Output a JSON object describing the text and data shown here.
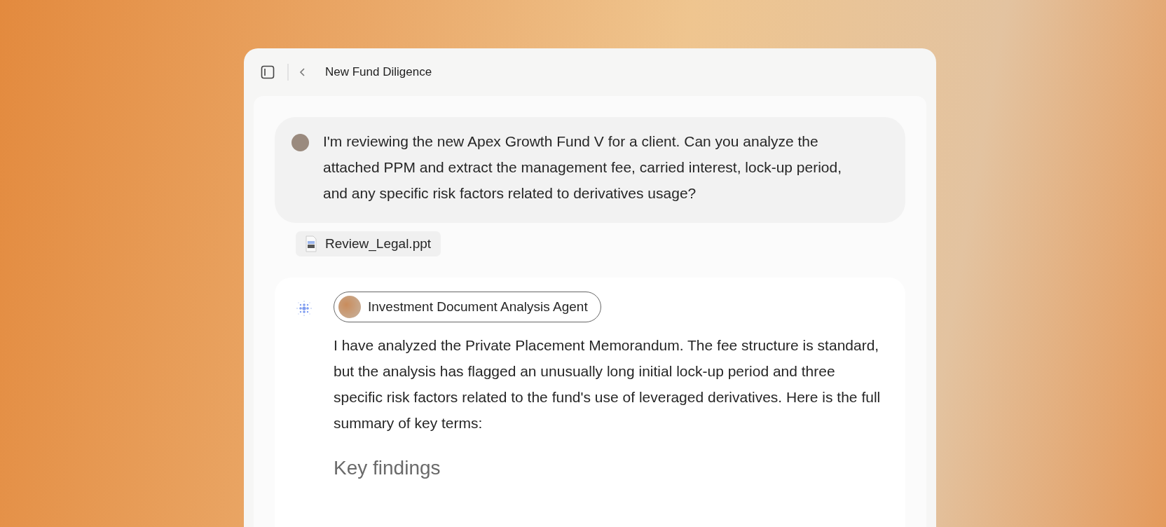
{
  "window": {
    "title": "New Fund Diligence"
  },
  "user_message": {
    "text": "I'm reviewing the new Apex Growth Fund V for a client. Can you analyze the attached PPM and extract the management fee, carried interest, lock-up period, and any specific risk factors related to derivatives usage?"
  },
  "attachments": [
    {
      "name": "Review_Legal.ppt"
    }
  ],
  "response": {
    "agent": "Investment Document Analysis Agent",
    "text": "I have analyzed the Private Placement Memorandum. The fee structure is standard, but the analysis has flagged an unusually long initial lock-up period and three specific risk factors related to the fund's use of leveraged derivatives. Here is the full summary of key terms:",
    "heading": "Key findings"
  }
}
